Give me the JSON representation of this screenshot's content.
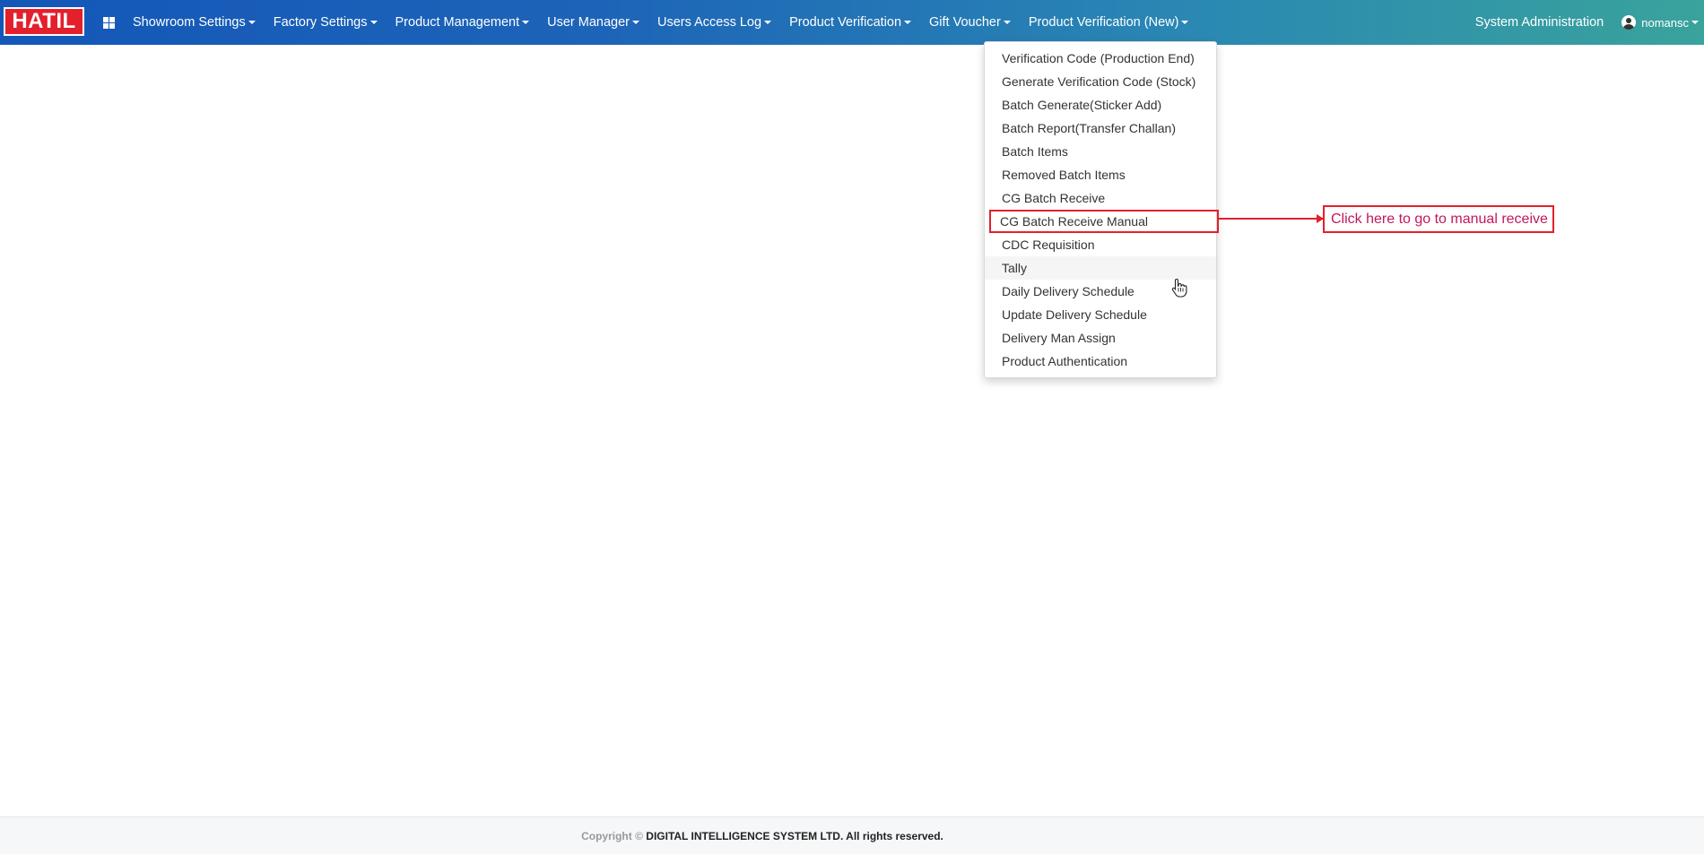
{
  "brand": {
    "logo_text": "HATIL",
    "color": "#e3202b"
  },
  "navbar": {
    "apps_icon": "apps-grid-icon",
    "items": [
      {
        "label": "Showroom Settings"
      },
      {
        "label": "Factory Settings"
      },
      {
        "label": "Product Management"
      },
      {
        "label": "User Manager"
      },
      {
        "label": "Users Access Log"
      },
      {
        "label": "Product Verification"
      },
      {
        "label": "Gift Voucher"
      },
      {
        "label": "Product Verification (New)"
      }
    ],
    "system_admin": "System Administration",
    "user": {
      "icon": "user-avatar-icon",
      "name": "nomansc"
    }
  },
  "dropdown": {
    "items": [
      {
        "label": "Verification Code (Production End)"
      },
      {
        "label": "Generate Verification Code (Stock)"
      },
      {
        "label": "Batch Generate(Sticker Add)"
      },
      {
        "label": "Batch Report(Transfer Challan)"
      },
      {
        "label": "Batch Items"
      },
      {
        "label": "Removed Batch Items"
      },
      {
        "label": "CG Batch Receive"
      },
      {
        "label": "CG Batch Receive Manual"
      },
      {
        "label": "CDC Requisition"
      },
      {
        "label": "Tally"
      },
      {
        "label": "Daily Delivery Schedule"
      },
      {
        "label": "Update Delivery Schedule"
      },
      {
        "label": "Delivery Man Assign"
      },
      {
        "label": "Product Authentication"
      }
    ]
  },
  "callout": {
    "text": "Click here to go to manual receive",
    "color": "#e3202b"
  },
  "footer": {
    "copyright": "Copyright ©",
    "company": "DIGITAL INTELLIGENCE SYSTEM LTD. All rights reserved."
  }
}
